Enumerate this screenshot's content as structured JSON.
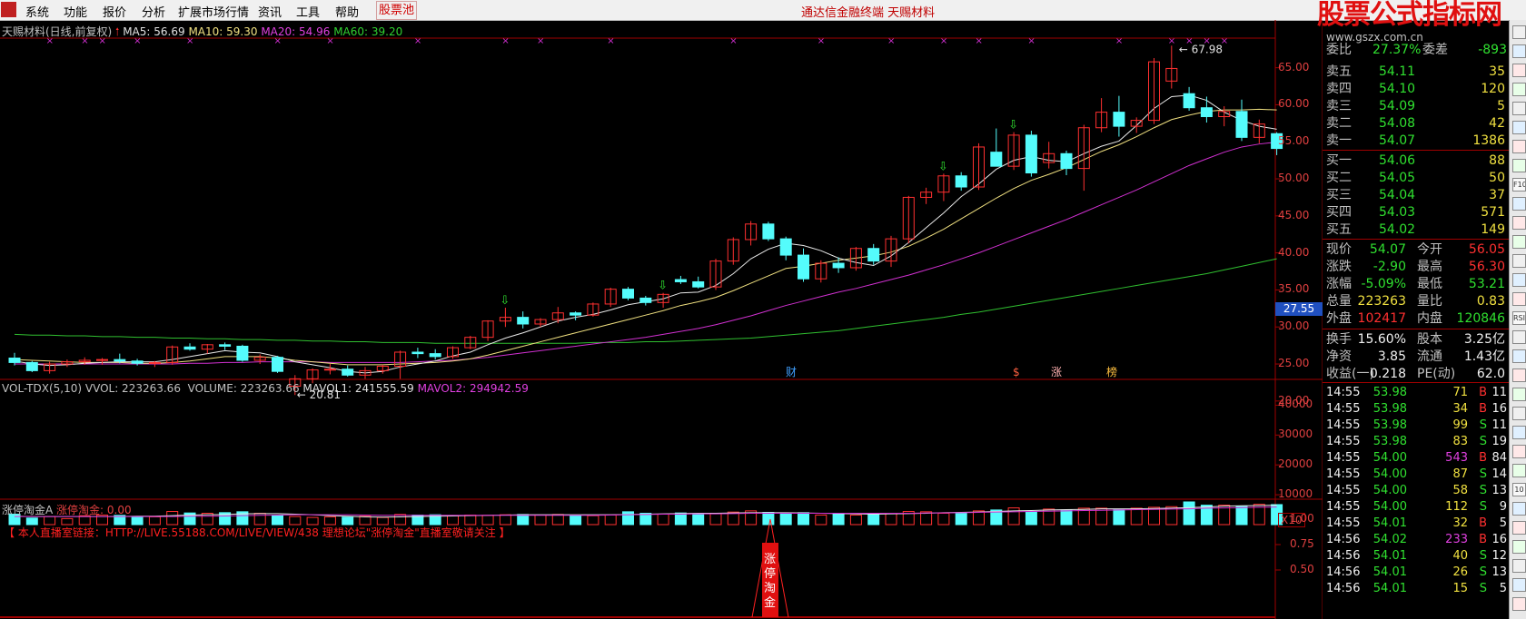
{
  "menu": {
    "items": [
      "系统",
      "功能",
      "报价",
      "分析",
      "扩展市场行情",
      "资讯",
      "工具",
      "帮助"
    ],
    "pool": "股票池",
    "center": "通达信金融终端    天赐材料",
    "watermark_main": "股票公式指标网",
    "watermark_sub": "www.gszx.com.cn"
  },
  "main": {
    "title": "天赐材料(日线,前复权)",
    "ma5": "MA5: 56.69",
    "ma10": "MA10: 59.30",
    "ma20": "MA20: 54.96",
    "ma60": "MA60: 39.20",
    "y_labels": [
      "65.00",
      "60.00",
      "55.00",
      "50.00",
      "45.00",
      "40.00",
      "35.00",
      "30.00",
      "25.00",
      "20.00"
    ],
    "current_price_tag": "27.55",
    "high_label": "67.98",
    "low_label": "20.81",
    "markers": [
      "财",
      "$",
      "涨",
      "榜"
    ]
  },
  "volume": {
    "title": "VOL-TDX(5,10)",
    "vvol": "VVOL: 223263.66",
    "volume": "VOLUME: 223263.66",
    "mavol1": "MAVOL1: 241555.59",
    "mavol2": "MAVOL2: 294942.59",
    "y_labels": [
      "40000",
      "30000",
      "20000",
      "10000"
    ],
    "unit": "X10"
  },
  "indicator": {
    "title": "涨停淘金A",
    "value": "涨停淘金: 0.00",
    "notice": "【 本人直播室链接：HTTP://LIVE.55188.COM/LIVE/VIEW/438 理想论坛\"涨停淘金\"直播室敬请关注 】",
    "y_labels": [
      "1.00",
      "0.75",
      "0.50"
    ],
    "tag_text": "涨停淘金"
  },
  "quote": {
    "top_row": {
      "label": "委比",
      "value": "27.37%",
      "label2": "委差",
      "value2": "-893"
    },
    "asks": [
      {
        "label": "卖五",
        "price": "54.11",
        "vol": "35"
      },
      {
        "label": "卖四",
        "price": "54.10",
        "vol": "120"
      },
      {
        "label": "卖三",
        "price": "54.09",
        "vol": "5"
      },
      {
        "label": "卖二",
        "price": "54.08",
        "vol": "42"
      },
      {
        "label": "卖一",
        "price": "54.07",
        "vol": "1386"
      }
    ],
    "bids": [
      {
        "label": "买一",
        "price": "54.06",
        "vol": "88"
      },
      {
        "label": "买二",
        "price": "54.05",
        "vol": "50"
      },
      {
        "label": "买三",
        "price": "54.04",
        "vol": "37"
      },
      {
        "label": "买四",
        "price": "54.03",
        "vol": "571"
      },
      {
        "label": "买五",
        "price": "54.02",
        "vol": "149"
      }
    ],
    "stats": [
      {
        "l1": "现价",
        "v1": "54.07",
        "l2": "今开",
        "v2": "56.05"
      },
      {
        "l1": "涨跌",
        "v1": "-2.90",
        "l2": "最高",
        "v2": "56.30"
      },
      {
        "l1": "涨幅",
        "v1": "-5.09%",
        "l2": "最低",
        "v2": "53.21"
      },
      {
        "l1": "总量",
        "v1": "223263",
        "l2": "量比",
        "v2": "0.83"
      },
      {
        "l1": "外盘",
        "v1": "102417",
        "l2": "内盘",
        "v2": "120846"
      }
    ],
    "fund": [
      {
        "l1": "换手",
        "v1": "15.60%",
        "l2": "股本",
        "v2": "3.25亿"
      },
      {
        "l1": "净资",
        "v1": "3.85",
        "l2": "流通",
        "v2": "1.43亿"
      },
      {
        "l1": "收益(一)",
        "v1": "0.218",
        "l2": "PE(动)",
        "v2": "62.0"
      }
    ],
    "ticks": [
      {
        "t": "14:55",
        "p": "53.98",
        "v": "71",
        "s": "B",
        "n": "11"
      },
      {
        "t": "14:55",
        "p": "53.98",
        "v": "34",
        "s": "B",
        "n": "16"
      },
      {
        "t": "14:55",
        "p": "53.98",
        "v": "99",
        "s": "S",
        "n": "11"
      },
      {
        "t": "14:55",
        "p": "53.98",
        "v": "83",
        "s": "S",
        "n": "19"
      },
      {
        "t": "14:55",
        "p": "54.00",
        "v": "543",
        "s": "B",
        "n": "84"
      },
      {
        "t": "14:55",
        "p": "54.00",
        "v": "87",
        "s": "S",
        "n": "14"
      },
      {
        "t": "14:55",
        "p": "54.00",
        "v": "58",
        "s": "S",
        "n": "13"
      },
      {
        "t": "14:55",
        "p": "54.00",
        "v": "112",
        "s": "S",
        "n": "9"
      },
      {
        "t": "14:55",
        "p": "54.01",
        "v": "32",
        "s": "B",
        "n": "5"
      },
      {
        "t": "14:56",
        "p": "54.02",
        "v": "233",
        "s": "B",
        "n": "16"
      },
      {
        "t": "14:56",
        "p": "54.01",
        "v": "40",
        "s": "S",
        "n": "12"
      },
      {
        "t": "14:56",
        "p": "54.01",
        "v": "26",
        "s": "S",
        "n": "13"
      },
      {
        "t": "14:56",
        "p": "54.01",
        "v": "15",
        "s": "S",
        "n": "5"
      }
    ]
  },
  "chart_data": {
    "type": "candlestick",
    "candles": [
      [
        25.8,
        26.5,
        24.8,
        25.2
      ],
      [
        25.2,
        25.4,
        23.9,
        24.1
      ],
      [
        24.1,
        25.3,
        23.7,
        25.0
      ],
      [
        25.0,
        25.6,
        24.6,
        25.3
      ],
      [
        25.3,
        25.9,
        24.9,
        25.5
      ],
      [
        25.5,
        25.8,
        24.9,
        25.6
      ],
      [
        25.6,
        26.4,
        25.1,
        25.4
      ],
      [
        25.4,
        25.7,
        24.8,
        25.1
      ],
      [
        25.1,
        25.4,
        24.6,
        25.2
      ],
      [
        25.2,
        27.5,
        24.9,
        27.3
      ],
      [
        27.3,
        27.8,
        26.8,
        27.0
      ],
      [
        27.0,
        27.7,
        26.4,
        27.6
      ],
      [
        27.6,
        27.9,
        26.9,
        27.4
      ],
      [
        27.4,
        27.6,
        25.3,
        25.5
      ],
      [
        25.5,
        26.3,
        25.0,
        25.9
      ],
      [
        25.9,
        26.1,
        23.8,
        24.0
      ],
      [
        22.0,
        23.5,
        20.81,
        23.0
      ],
      [
        23.0,
        24.4,
        22.4,
        24.2
      ],
      [
        24.2,
        25.0,
        23.6,
        24.3
      ],
      [
        24.3,
        24.8,
        23.3,
        23.5
      ],
      [
        23.5,
        24.6,
        23.0,
        24.1
      ],
      [
        24.1,
        24.9,
        23.7,
        24.7
      ],
      [
        24.7,
        26.8,
        23.0,
        26.6
      ],
      [
        26.6,
        27.2,
        25.8,
        26.4
      ],
      [
        26.4,
        27.0,
        25.6,
        26.0
      ],
      [
        26.0,
        27.4,
        25.7,
        27.2
      ],
      [
        27.2,
        28.8,
        27.0,
        28.6
      ],
      [
        28.6,
        30.9,
        28.1,
        30.8
      ],
      [
        30.8,
        32.6,
        30.0,
        31.3
      ],
      [
        31.3,
        32.1,
        29.8,
        30.4
      ],
      [
        30.4,
        31.2,
        30.0,
        31.0
      ],
      [
        31.0,
        32.7,
        30.5,
        31.9
      ],
      [
        31.9,
        32.1,
        30.9,
        31.6
      ],
      [
        31.6,
        33.3,
        31.4,
        33.1
      ],
      [
        33.1,
        35.3,
        32.7,
        35.1
      ],
      [
        35.1,
        35.4,
        33.6,
        33.9
      ],
      [
        33.9,
        34.2,
        32.9,
        33.3
      ],
      [
        33.3,
        34.6,
        32.6,
        34.4
      ],
      [
        36.4,
        36.9,
        35.8,
        36.1
      ],
      [
        36.1,
        36.8,
        35.2,
        35.4
      ],
      [
        35.4,
        39.2,
        35.0,
        38.9
      ],
      [
        38.9,
        42.1,
        38.4,
        41.8
      ],
      [
        41.8,
        44.3,
        41.0,
        43.9
      ],
      [
        43.9,
        44.2,
        41.6,
        41.9
      ],
      [
        41.9,
        42.2,
        39.0,
        39.7
      ],
      [
        39.7,
        40.6,
        36.1,
        36.5
      ],
      [
        36.5,
        39.0,
        36.0,
        38.6
      ],
      [
        38.6,
        39.4,
        37.3,
        38.0
      ],
      [
        38.0,
        40.8,
        37.6,
        40.6
      ],
      [
        40.6,
        41.2,
        38.4,
        38.9
      ],
      [
        38.9,
        42.3,
        38.1,
        41.9
      ],
      [
        41.9,
        47.7,
        41.3,
        47.5
      ],
      [
        47.5,
        48.8,
        46.6,
        48.2
      ],
      [
        48.2,
        50.7,
        47.0,
        50.4
      ],
      [
        50.4,
        50.9,
        48.4,
        48.9
      ],
      [
        48.9,
        54.8,
        48.5,
        54.3
      ],
      [
        53.6,
        56.8,
        53.2,
        51.7
      ],
      [
        51.7,
        56.3,
        51.2,
        55.9
      ],
      [
        55.9,
        56.5,
        50.3,
        50.8
      ],
      [
        52.2,
        55.0,
        51.4,
        53.4
      ],
      [
        53.4,
        53.8,
        50.5,
        51.4
      ],
      [
        51.4,
        57.3,
        48.4,
        56.9
      ],
      [
        56.9,
        60.9,
        56.3,
        59.0
      ],
      [
        59.0,
        61.2,
        55.7,
        57.1
      ],
      [
        57.1,
        58.3,
        56.2,
        57.9
      ],
      [
        57.9,
        66.3,
        57.4,
        65.8
      ],
      [
        63.2,
        67.98,
        62.2,
        64.9
      ],
      [
        61.5,
        62.4,
        59.2,
        59.6
      ],
      [
        59.6,
        61.1,
        57.6,
        58.4
      ],
      [
        58.4,
        59.8,
        57.1,
        59.1
      ],
      [
        59.1,
        60.7,
        55.1,
        55.6
      ],
      [
        55.6,
        58.0,
        54.8,
        57.4
      ],
      [
        56.1,
        56.3,
        53.2,
        54.1
      ]
    ],
    "ma5": [
      25.4,
      25.0,
      24.8,
      24.9,
      25.1,
      25.2,
      25.3,
      25.3,
      25.3,
      25.6,
      26.0,
      26.4,
      26.8,
      26.6,
      26.5,
      26.0,
      25.3,
      24.9,
      24.5,
      24.0,
      23.8,
      24.0,
      24.6,
      25.0,
      25.4,
      26.1,
      26.6,
      27.6,
      28.5,
      29.2,
      30.0,
      30.8,
      31.3,
      31.7,
      32.3,
      33.0,
      33.4,
      33.8,
      34.6,
      34.7,
      35.6,
      37.2,
      39.2,
      40.5,
      41.3,
      41.0,
      40.3,
      39.3,
      38.7,
      38.3,
      39.6,
      41.4,
      43.4,
      45.4,
      47.6,
      49.3,
      51.3,
      52.5,
      53.0,
      52.5,
      52.3,
      53.4,
      54.4,
      55.1,
      57.2,
      59.5,
      61.1,
      61.3,
      60.6,
      59.0,
      57.9,
      57.1,
      56.7
    ],
    "ma10": [
      25.6,
      25.5,
      25.4,
      25.3,
      25.2,
      25.2,
      25.2,
      25.1,
      25.1,
      25.2,
      25.4,
      25.7,
      26.0,
      26.0,
      26.0,
      25.8,
      25.5,
      25.3,
      25.1,
      24.9,
      24.9,
      24.9,
      25.0,
      25.1,
      25.2,
      25.4,
      25.7,
      26.2,
      26.8,
      27.4,
      28.0,
      28.6,
      29.2,
      29.8,
      30.4,
      31.0,
      31.6,
      32.2,
      32.9,
      33.4,
      34.0,
      34.9,
      35.9,
      36.9,
      37.9,
      38.2,
      38.6,
      39.0,
      39.3,
      39.6,
      40.1,
      40.9,
      42.0,
      43.2,
      44.6,
      46.0,
      47.4,
      48.7,
      49.8,
      50.6,
      51.5,
      52.6,
      53.7,
      54.6,
      55.7,
      56.9,
      58.0,
      58.6,
      59.1,
      59.3,
      59.3,
      59.4,
      59.3
    ],
    "ma20": [
      25.0,
      25.0,
      25.0,
      25.0,
      25.0,
      25.0,
      25.0,
      25.0,
      25.0,
      25.0,
      25.1,
      25.1,
      25.2,
      25.2,
      25.3,
      25.3,
      25.3,
      25.3,
      25.2,
      25.2,
      25.2,
      25.2,
      25.2,
      25.3,
      25.4,
      25.5,
      25.7,
      25.9,
      26.2,
      26.5,
      26.8,
      27.1,
      27.4,
      27.7,
      28.0,
      28.3,
      28.6,
      29.0,
      29.4,
      29.8,
      30.3,
      30.9,
      31.5,
      32.2,
      32.9,
      33.5,
      34.1,
      34.7,
      35.2,
      35.8,
      36.4,
      37.0,
      37.7,
      38.4,
      39.2,
      40.0,
      40.9,
      41.8,
      42.7,
      43.6,
      44.5,
      45.5,
      46.5,
      47.5,
      48.5,
      49.6,
      50.7,
      51.8,
      52.7,
      53.6,
      54.3,
      54.7,
      54.96
    ],
    "ma60": [
      29.0,
      28.9,
      28.9,
      28.8,
      28.8,
      28.7,
      28.7,
      28.6,
      28.6,
      28.5,
      28.5,
      28.4,
      28.4,
      28.3,
      28.3,
      28.2,
      28.2,
      28.1,
      28.1,
      28.0,
      28.0,
      27.9,
      27.9,
      27.9,
      27.8,
      27.8,
      27.8,
      27.8,
      27.8,
      27.8,
      27.8,
      27.8,
      27.8,
      27.9,
      27.9,
      27.9,
      28.0,
      28.0,
      28.1,
      28.2,
      28.3,
      28.4,
      28.5,
      28.7,
      28.9,
      29.1,
      29.3,
      29.5,
      29.8,
      30.1,
      30.4,
      30.7,
      31.0,
      31.3,
      31.7,
      32.0,
      32.4,
      32.8,
      33.2,
      33.6,
      34.0,
      34.4,
      34.8,
      35.2,
      35.6,
      36.0,
      36.4,
      36.8,
      37.2,
      37.7,
      38.2,
      38.7,
      39.2
    ],
    "volumes": [
      3500,
      2200,
      2700,
      2000,
      3000,
      3200,
      3100,
      2600,
      2600,
      4400,
      3900,
      3800,
      4000,
      4300,
      3800,
      3100,
      2700,
      2400,
      2600,
      2500,
      2800,
      2400,
      3400,
      3200,
      3300,
      3000,
      3200,
      3100,
      3300,
      3400,
      3200,
      3400,
      3100,
      3000,
      3200,
      4300,
      3800,
      3500,
      3900,
      3600,
      3700,
      4200,
      4600,
      4100,
      3800,
      4000,
      3200,
      3500,
      3200,
      3500,
      3800,
      4400,
      4300,
      3800,
      3900,
      4600,
      4900,
      5600,
      4300,
      5200,
      4900,
      5500,
      5500,
      5000,
      5500,
      5800,
      6000,
      7600,
      6500,
      6500,
      6200,
      6800,
      6700
    ],
    "mavol1": [
      2800,
      2700,
      2700,
      2700,
      2700,
      2700,
      2700,
      2800,
      2800,
      3000,
      3200,
      3300,
      3400,
      3600,
      3700,
      3700,
      3500,
      3300,
      3000,
      2800,
      2600,
      2500,
      2600,
      2700,
      2800,
      2900,
      3000,
      3100,
      3200,
      3300,
      3300,
      3300,
      3300,
      3300,
      3300,
      3400,
      3500,
      3600,
      3700,
      3800,
      3800,
      3900,
      4000,
      4000,
      4000,
      3900,
      3800,
      3700,
      3600,
      3500,
      3600,
      3700,
      3800,
      4000,
      4100,
      4200,
      4400,
      4600,
      4700,
      4900,
      5000,
      5100,
      5300,
      5300,
      5300,
      5400,
      5500,
      5700,
      5900,
      6200,
      6300,
      6400,
      6500
    ],
    "mavol2": [
      2700,
      2700,
      2700,
      2700,
      2700,
      2700,
      2700,
      2700,
      2700,
      2700,
      2800,
      2800,
      2900,
      3000,
      3100,
      3200,
      3300,
      3300,
      3300,
      3300,
      3200,
      3100,
      3100,
      3100,
      3100,
      3100,
      3100,
      3100,
      3100,
      3100,
      3100,
      3100,
      3100,
      3100,
      3200,
      3300,
      3400,
      3500,
      3500,
      3600,
      3600,
      3700,
      3800,
      3800,
      3800,
      3800,
      3800,
      3800,
      3800,
      3800,
      3800,
      3800,
      3900,
      3900,
      4000,
      4100,
      4200,
      4300,
      4400,
      4500,
      4600,
      4700,
      4800,
      4900,
      5000,
      5100,
      5200,
      5300,
      5500,
      5600,
      5700,
      5800,
      5900
    ],
    "y_range": [
      19,
      69
    ],
    "vol_range": [
      0,
      45000
    ]
  }
}
